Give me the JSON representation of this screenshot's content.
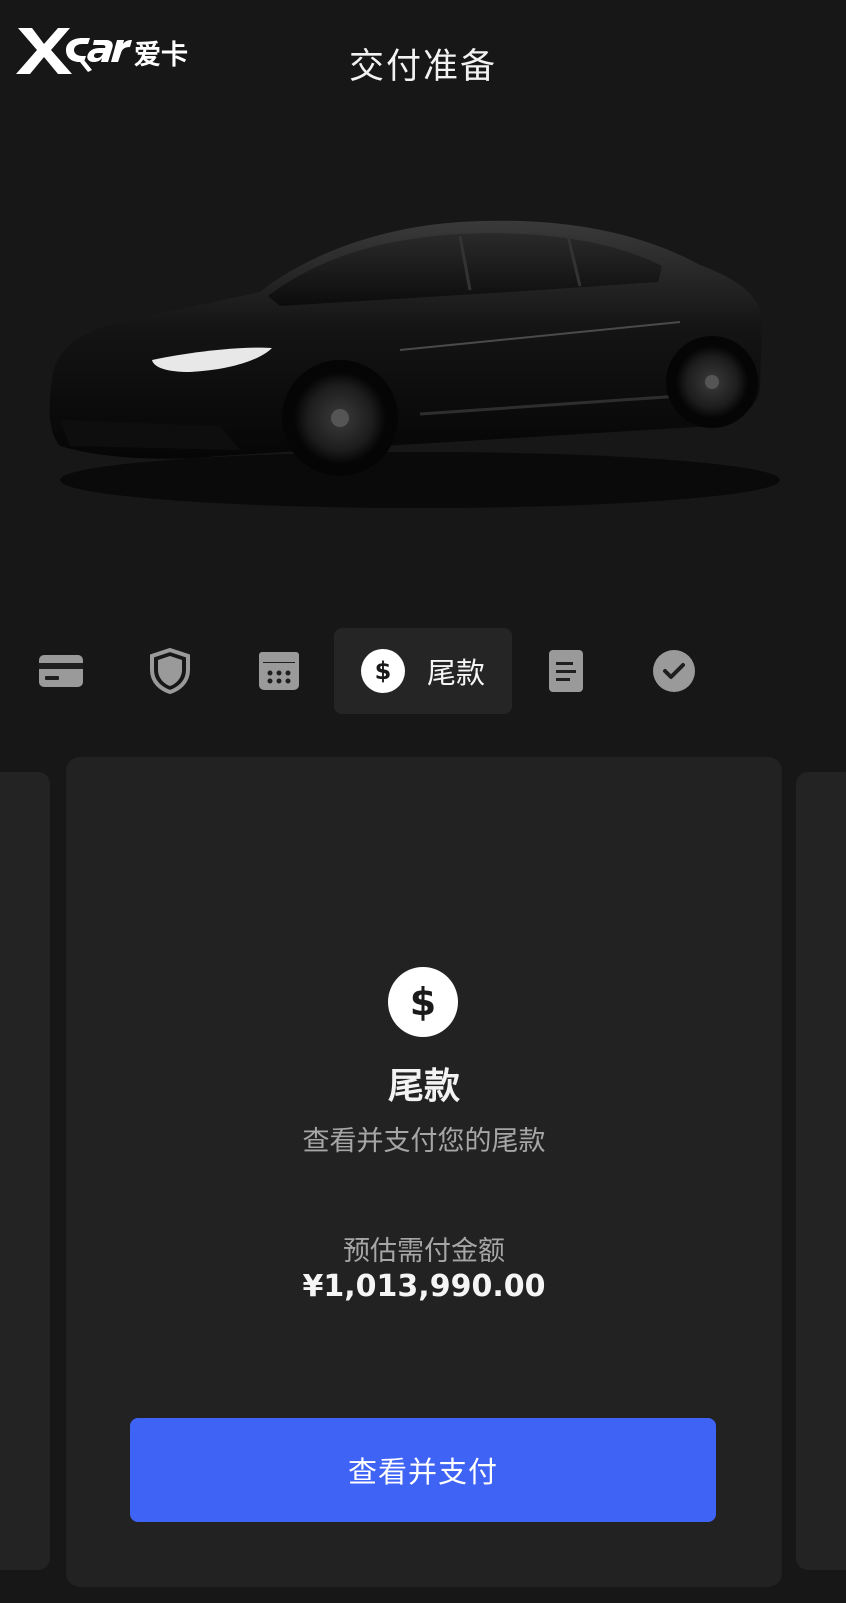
{
  "watermark": {
    "brand_text": "Xcar爱卡"
  },
  "header": {
    "title": "交付准备"
  },
  "steps": {
    "items": [
      {
        "icon": "credit-card-icon"
      },
      {
        "icon": "shield-icon"
      },
      {
        "icon": "calendar-icon"
      },
      {
        "icon": "dollar-icon",
        "symbol": "$",
        "label": "尾款",
        "active": true
      },
      {
        "icon": "document-icon"
      },
      {
        "icon": "checkmark-icon"
      }
    ]
  },
  "card": {
    "icon": "dollar-icon",
    "icon_symbol": "$",
    "title": "尾款",
    "description": "查看并支付您的尾款",
    "amount_label": "预估需付金额",
    "amount_value": "¥1,013,990.00",
    "button_label": "查看并支付"
  },
  "colors": {
    "background": "#171717",
    "card": "#222222",
    "primary_button": "#3e63f5"
  }
}
